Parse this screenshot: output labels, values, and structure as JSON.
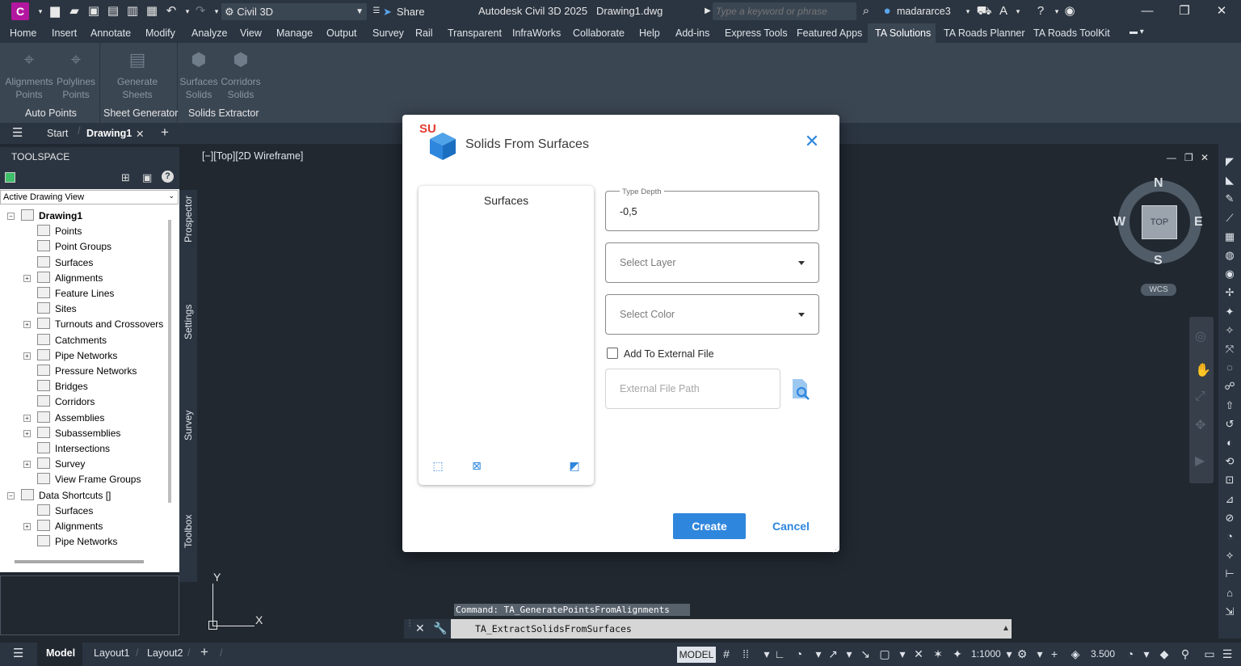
{
  "titlebar": {
    "logo": "C",
    "workspace": "Civil 3D",
    "share": "Share",
    "title": "Autodesk Civil 3D 2025",
    "doc_name": "Drawing1.dwg",
    "search_placeholder": "Type a keyword or phrase",
    "user": "madararce3"
  },
  "menu": [
    "Home",
    "Insert",
    "Annotate",
    "Modify",
    "Analyze",
    "View",
    "Manage",
    "Output",
    "Survey",
    "Rail",
    "Transparent",
    "InfraWorks",
    "Collaborate",
    "Help",
    "Add-ins",
    "Express Tools",
    "Featured Apps",
    "TA Solutions",
    "TA Roads Planner",
    "TA Roads ToolKit"
  ],
  "ribbon": {
    "buttons": [
      {
        "line1": "Alignments",
        "line2": "Points"
      },
      {
        "line1": "Polylines",
        "line2": "Points"
      },
      {
        "line1": "Generate",
        "line2": "Sheets"
      },
      {
        "line1": "Surfaces",
        "line2": "Solids"
      },
      {
        "line1": "Corridors",
        "line2": "Solids"
      }
    ],
    "panels": [
      "Auto Points",
      "Sheet Generator",
      "Solids Extractor"
    ]
  },
  "doctabs": {
    "start": "Start",
    "drawing": "Drawing1"
  },
  "toolspace": {
    "title": "TOOLSPACE",
    "view": "Active Drawing View",
    "vtabs": [
      "Prospector",
      "Settings",
      "Survey",
      "Toolbox"
    ],
    "tree": [
      {
        "label": "Drawing1",
        "level": 0,
        "bold": true,
        "exp": "-"
      },
      {
        "label": "Points",
        "level": 1
      },
      {
        "label": "Point Groups",
        "level": 1
      },
      {
        "label": "Surfaces",
        "level": 1
      },
      {
        "label": "Alignments",
        "level": 1,
        "exp": "+"
      },
      {
        "label": "Feature Lines",
        "level": 1
      },
      {
        "label": "Sites",
        "level": 1
      },
      {
        "label": "Turnouts and Crossovers",
        "level": 1,
        "exp": "+"
      },
      {
        "label": "Catchments",
        "level": 1
      },
      {
        "label": "Pipe Networks",
        "level": 1,
        "exp": "+"
      },
      {
        "label": "Pressure Networks",
        "level": 1
      },
      {
        "label": "Bridges",
        "level": 1
      },
      {
        "label": "Corridors",
        "level": 1
      },
      {
        "label": "Assemblies",
        "level": 1,
        "exp": "+"
      },
      {
        "label": "Subassemblies",
        "level": 1,
        "exp": "+"
      },
      {
        "label": "Intersections",
        "level": 1
      },
      {
        "label": "Survey",
        "level": 1,
        "exp": "+"
      },
      {
        "label": "View Frame Groups",
        "level": 1
      },
      {
        "label": "Data Shortcuts []",
        "level": 0,
        "exp": "-"
      },
      {
        "label": "Surfaces",
        "level": 1
      },
      {
        "label": "Alignments",
        "level": 1,
        "exp": "+"
      },
      {
        "label": "Pipe Networks",
        "level": 1
      }
    ]
  },
  "viewport": {
    "label": "[−][Top][2D Wireframe]",
    "compass": {
      "n": "N",
      "s": "S",
      "e": "E",
      "w": "W",
      "top": "TOP",
      "wcs": "WCS"
    },
    "ucs": {
      "x": "X",
      "y": "Y"
    }
  },
  "command": {
    "history": "Command: TA_GeneratePointsFromAlignments",
    "input": "TA_ExtractSolidsFromSurfaces"
  },
  "statusbar": {
    "tabs": [
      "Model",
      "Layout1",
      "Layout2"
    ],
    "model": "MODEL",
    "scale": "1:1000",
    "value": "3.500"
  },
  "dialog": {
    "logo_text": "SU",
    "title": "Solids From Surfaces",
    "surfaces_title": "Surfaces",
    "depth_label": "Type Depth",
    "depth_value": "-0,5",
    "layer_placeholder": "Select Layer",
    "color_placeholder": "Select Color",
    "checkbox_label": "Add To External File",
    "external_placeholder": "External File Path",
    "create": "Create",
    "cancel": "Cancel",
    "accent": "#2f86dd"
  }
}
